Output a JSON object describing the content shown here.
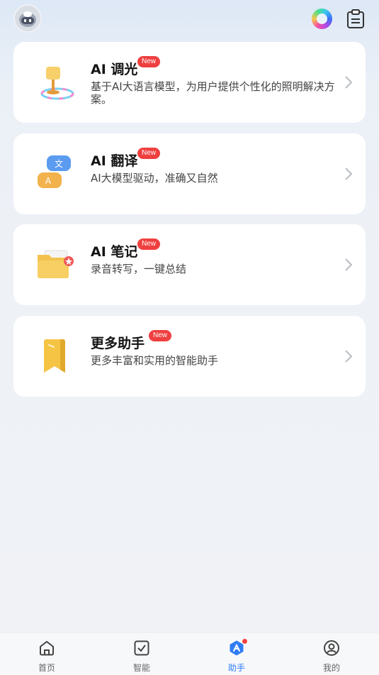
{
  "header": {
    "avatar_icon": "robot-avatar-icon",
    "ai_orb_icon": "ai-orb-icon",
    "clipboard_icon": "clipboard-icon"
  },
  "cards": [
    {
      "title": "AI 调光",
      "badge": "New",
      "desc": "基于AI大语言模型，为用户提供个性化的照明解决方案。",
      "icon": "lamp-icon"
    },
    {
      "title": "AI 翻译",
      "badge": "New",
      "desc": "AI大模型驱动，准确又自然",
      "icon": "translate-icon"
    },
    {
      "title": "AI 笔记",
      "badge": "New",
      "desc": "录音转写，一键总结",
      "icon": "folder-note-icon"
    },
    {
      "title": "更多助手",
      "badge": "New",
      "desc": "更多丰富和实用的智能助手",
      "icon": "bookmark-icon"
    }
  ],
  "tabs": [
    {
      "label": "首页",
      "icon": "home-icon",
      "active": false
    },
    {
      "label": "智能",
      "icon": "checkbox-icon",
      "active": false
    },
    {
      "label": "助手",
      "icon": "assistant-icon",
      "active": true
    },
    {
      "label": "我的",
      "icon": "profile-icon",
      "active": false
    }
  ],
  "colors": {
    "accent": "#2f7cf6",
    "badge": "#ef3f3f",
    "card_bg": "#ffffff",
    "page_bg": "#eef1f6"
  }
}
